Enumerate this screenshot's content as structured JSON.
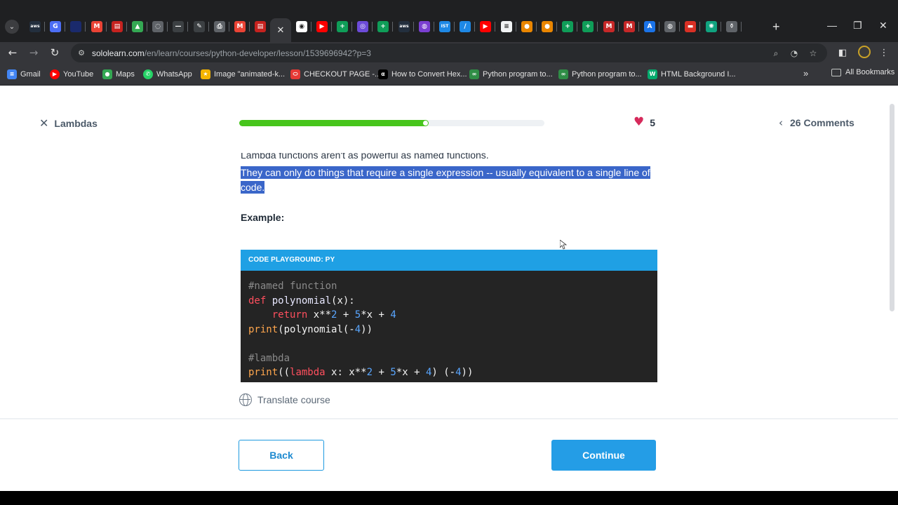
{
  "browser": {
    "tabs": [
      {
        "icon": "aws-icon",
        "glyph": "aws",
        "color": "#232f3e"
      },
      {
        "icon": "g-circle-icon",
        "glyph": "G",
        "color": "#4c6ef5"
      },
      {
        "icon": "window-icon",
        "glyph": "",
        "color": "#1a2a6c"
      },
      {
        "icon": "gmail-icon",
        "glyph": "M",
        "color": "#ea4335"
      },
      {
        "icon": "red-doc-icon",
        "glyph": "▤",
        "color": "#c5221f"
      },
      {
        "icon": "drive-icon",
        "glyph": "▲",
        "color": "#34a853"
      },
      {
        "icon": "compass-icon",
        "glyph": "◌",
        "color": "#5f6368"
      },
      {
        "icon": "dash-icon",
        "glyph": "—",
        "color": "#3c4043"
      },
      {
        "icon": "pen-icon",
        "glyph": "✎",
        "color": "#3c4043"
      },
      {
        "icon": "printer-icon",
        "glyph": "⎙",
        "color": "#5f6368"
      },
      {
        "icon": "gmail-icon",
        "glyph": "M",
        "color": "#ea4335"
      },
      {
        "icon": "red-doc-icon",
        "glyph": "▤",
        "color": "#c5221f"
      },
      {
        "icon": "close-icon",
        "glyph": "✕",
        "color": "#35363a",
        "active": true
      },
      {
        "icon": "sololearn-icon",
        "glyph": "◉",
        "color": "#ffffff"
      },
      {
        "icon": "youtube-icon",
        "glyph": "▶",
        "color": "#ff0000"
      },
      {
        "icon": "sheets-icon",
        "glyph": "+",
        "color": "#0f9d58"
      },
      {
        "icon": "purple-circle-icon",
        "glyph": "◎",
        "color": "#6c4bd8"
      },
      {
        "icon": "sheets-icon",
        "glyph": "+",
        "color": "#0f9d58"
      },
      {
        "icon": "aws-icon",
        "glyph": "aws",
        "color": "#232f3e"
      },
      {
        "icon": "purple-shield-icon",
        "glyph": "◍",
        "color": "#7a3fd1"
      },
      {
        "icon": "ist-icon",
        "glyph": "IST",
        "color": "#1e88e5"
      },
      {
        "icon": "pencil-icon",
        "glyph": "∕",
        "color": "#1e88e5"
      },
      {
        "icon": "youtube-icon",
        "glyph": "▶",
        "color": "#ff0000"
      },
      {
        "icon": "white-doc-icon",
        "glyph": "≡",
        "color": "#f1f3f4"
      },
      {
        "icon": "maps-pin-icon",
        "glyph": "●",
        "color": "#ea8600"
      },
      {
        "icon": "maps-pin-icon",
        "glyph": "●",
        "color": "#ea8600"
      },
      {
        "icon": "sheets-icon",
        "glyph": "+",
        "color": "#0f9d58"
      },
      {
        "icon": "sheets-icon",
        "glyph": "+",
        "color": "#0f9d58"
      },
      {
        "icon": "m-red-icon",
        "glyph": "M",
        "color": "#c62828"
      },
      {
        "icon": "m-red-icon",
        "glyph": "M",
        "color": "#c62828"
      },
      {
        "icon": "a-triangle-icon",
        "glyph": "A",
        "color": "#1a73e8"
      },
      {
        "icon": "globe-icon",
        "glyph": "◍",
        "color": "#5f6368"
      },
      {
        "icon": "red-bar-icon",
        "glyph": "▬",
        "color": "#d93025"
      },
      {
        "icon": "chatgpt-icon",
        "glyph": "✺",
        "color": "#10a37f"
      },
      {
        "icon": "bottle-icon",
        "glyph": "⚱",
        "color": "#5f6368"
      }
    ],
    "url_host": "sololearn.com",
    "url_path": "/en/learn/courses/python-developer/lesson/1539696942?p=3",
    "bookmarks": [
      {
        "label": "Gmail",
        "icon": "google-apps-icon",
        "glyph": "≡",
        "color": "#4285f4"
      },
      {
        "label": "YouTube",
        "icon": "youtube-icon",
        "glyph": "▶",
        "color": "#ff0000"
      },
      {
        "label": "Maps",
        "icon": "maps-pin-icon",
        "glyph": "●",
        "color": "#34a853"
      },
      {
        "label": "WhatsApp",
        "icon": "whatsapp-icon",
        "glyph": "✆",
        "color": "#25d366"
      },
      {
        "label": "Image \"animated-k...",
        "icon": "star-icon",
        "glyph": "★",
        "color": "#f5b400"
      },
      {
        "label": "CHECKOUT PAGE -...",
        "icon": "pill-icon",
        "glyph": "⬭",
        "color": "#e53935"
      },
      {
        "label": "How to Convert Hex...",
        "icon": "alpha-icon",
        "glyph": "α",
        "color": "#000000"
      },
      {
        "label": "Python program to...",
        "icon": "gfg-icon",
        "glyph": "∞",
        "color": "#2f8d46"
      },
      {
        "label": "Python program to...",
        "icon": "gfg-icon",
        "glyph": "∞",
        "color": "#2f8d46"
      },
      {
        "label": "HTML Background I...",
        "icon": "w3-icon",
        "glyph": "W",
        "color": "#04aa6d"
      }
    ],
    "all_bookmarks": "All Bookmarks"
  },
  "lesson": {
    "title": "Lambdas",
    "progress": 0.62,
    "hearts": "5",
    "comments": "26 Comments",
    "cut_line": "Lambda functions aren't as powerful as named functions.",
    "selected_text": "They can only do things that require a single expression -- usually equivalent to a single line of code.",
    "example_label": "Example:",
    "playground_title": "CODE PLAYGROUND: PY",
    "translate": "Translate course",
    "back": "Back",
    "continue": "Continue"
  },
  "code": {
    "l1": "#named function",
    "l2_kw": "def",
    "l2_fn": " polynomial",
    "l2_rest": "(x):",
    "l3_kw": "    return",
    "l3_a": " x**",
    "l3_n1": "2",
    "l3_b": " + ",
    "l3_n2": "5",
    "l3_c": "*x + ",
    "l3_n3": "4",
    "l4_bi": "print",
    "l4_a": "(polynomial(-",
    "l4_n": "4",
    "l4_b": "))",
    "l6": "#lambda",
    "l7_bi": "print",
    "l7_a": "((",
    "l7_kw": "lambda",
    "l7_b": " x: x**",
    "l7_n1": "2",
    "l7_c": " + ",
    "l7_n2": "5",
    "l7_d": "*x + ",
    "l7_n3": "4",
    "l7_e": ") (-",
    "l7_n4": "4",
    "l7_f": "))"
  },
  "colors": {
    "accent": "#249de6",
    "progress": "#47c51c",
    "heart": "#d62a5b",
    "selection": "#3a66c9"
  }
}
